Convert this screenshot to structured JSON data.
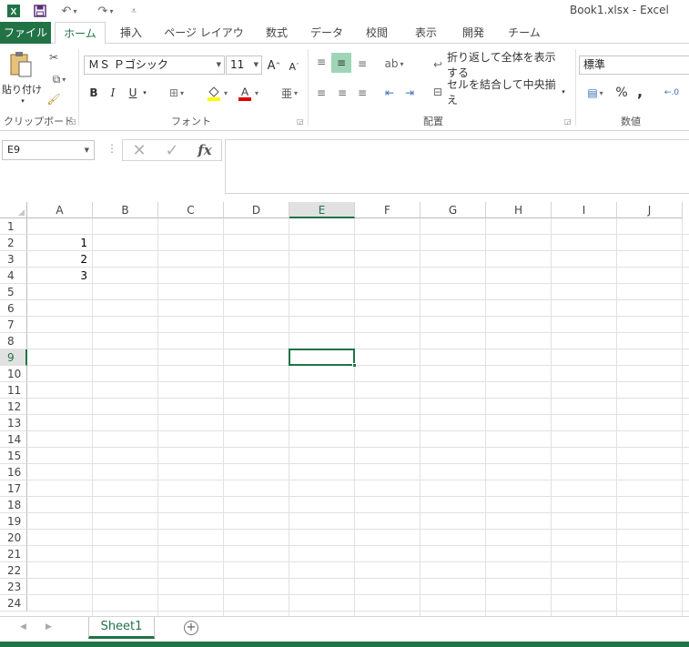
{
  "window": {
    "title": "Book1.xlsx - Excel"
  },
  "quick_access": {
    "save_icon": "save-icon",
    "undo_icon": "undo-icon",
    "redo_icon": "redo-icon",
    "customize_icon": "customize-icon"
  },
  "tabs": [
    {
      "label": "ファイル"
    },
    {
      "label": "ホーム"
    },
    {
      "label": "挿入"
    },
    {
      "label": "ページ レイアウト"
    },
    {
      "label": "数式"
    },
    {
      "label": "データ"
    },
    {
      "label": "校閲"
    },
    {
      "label": "表示"
    },
    {
      "label": "開発"
    },
    {
      "label": "チーム"
    }
  ],
  "ribbon": {
    "clipboard": {
      "label": "クリップボード",
      "paste_label": "貼り付け"
    },
    "font": {
      "label": "フォント",
      "font_name": "ＭＳ Ｐゴシック",
      "font_size": "11",
      "bold": "B",
      "italic": "I",
      "underline": "U"
    },
    "alignment": {
      "label": "配置",
      "wrap_text": "折り返して全体を表示する",
      "merge_center": "セルを結合して中央揃え"
    },
    "number": {
      "label": "数値",
      "format": "標準",
      "percent": "%",
      "comma": ","
    }
  },
  "formula_bar": {
    "name_box": "E9",
    "cancel": "✕",
    "enter": "✓",
    "fx": "fx",
    "content": ""
  },
  "grid": {
    "columns": [
      "A",
      "B",
      "C",
      "D",
      "E",
      "F",
      "G",
      "H",
      "I",
      "J"
    ],
    "rows": [
      "1",
      "2",
      "3",
      "4",
      "5",
      "6",
      "7",
      "8",
      "9",
      "10",
      "11",
      "12",
      "13",
      "14",
      "15",
      "16",
      "17",
      "18",
      "19",
      "20",
      "21",
      "22",
      "23",
      "24"
    ],
    "selected_column": "E",
    "selected_row": "9",
    "cells": [
      {
        "ref": "A2",
        "value": "1"
      },
      {
        "ref": "A3",
        "value": "2"
      },
      {
        "ref": "A4",
        "value": "3"
      }
    ]
  },
  "sheets": [
    {
      "name": "Sheet1",
      "active": true
    }
  ],
  "colors": {
    "accent": "#217346",
    "grid_line": "#e1e1e1",
    "header_sel": "#e1e1e1"
  }
}
